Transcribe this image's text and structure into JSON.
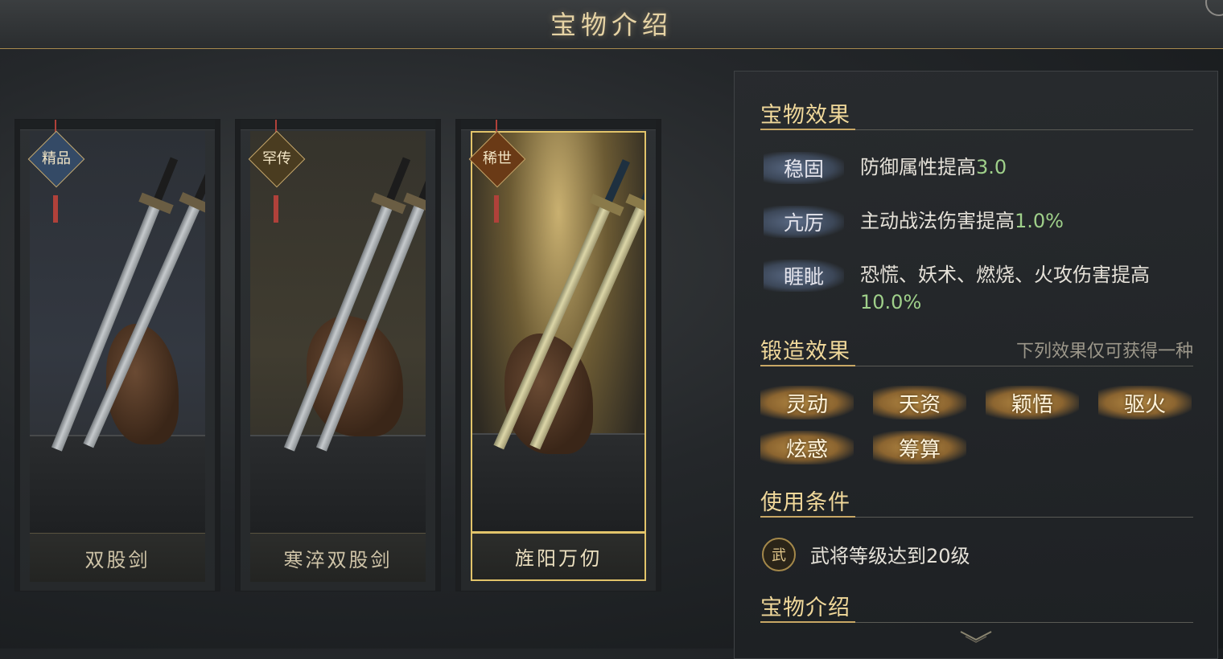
{
  "header": {
    "title": "宝物介绍"
  },
  "treasures": [
    {
      "name": "双股剑",
      "grade": "精品",
      "grade_color": "#344a66",
      "selected": false
    },
    {
      "name": "寒淬双股剑",
      "grade": "罕传",
      "grade_color": "#4a3c20",
      "selected": false
    },
    {
      "name": "旌阳万仞",
      "grade": "稀世",
      "grade_color": "#6a3a16",
      "selected": true
    }
  ],
  "panel": {
    "treasure_effect": {
      "title": "宝物效果",
      "items": [
        {
          "tag": "稳固",
          "text": "防御属性提高",
          "value": "3.0"
        },
        {
          "tag": "亢厉",
          "text": "主动战法伤害提高",
          "value": "1.0%"
        },
        {
          "tag": "睚眦",
          "text": "恐慌、妖术、燃烧、火攻伤害提高",
          "value": "10.0%"
        }
      ]
    },
    "forge_effect": {
      "title": "锻造效果",
      "note": "下列效果仅可获得一种",
      "chips": [
        "灵动",
        "天资",
        "颖悟",
        "驱火",
        "炫惑",
        "筹算"
      ]
    },
    "use_condition": {
      "title": "使用条件",
      "icon_char": "武",
      "text": "武将等级达到20级"
    },
    "treasure_intro": {
      "title": "宝物介绍"
    }
  },
  "colors": {
    "accent_gold": "#e2c46a",
    "value_green": "#9fd08a",
    "section_title": "#f0d89a"
  }
}
